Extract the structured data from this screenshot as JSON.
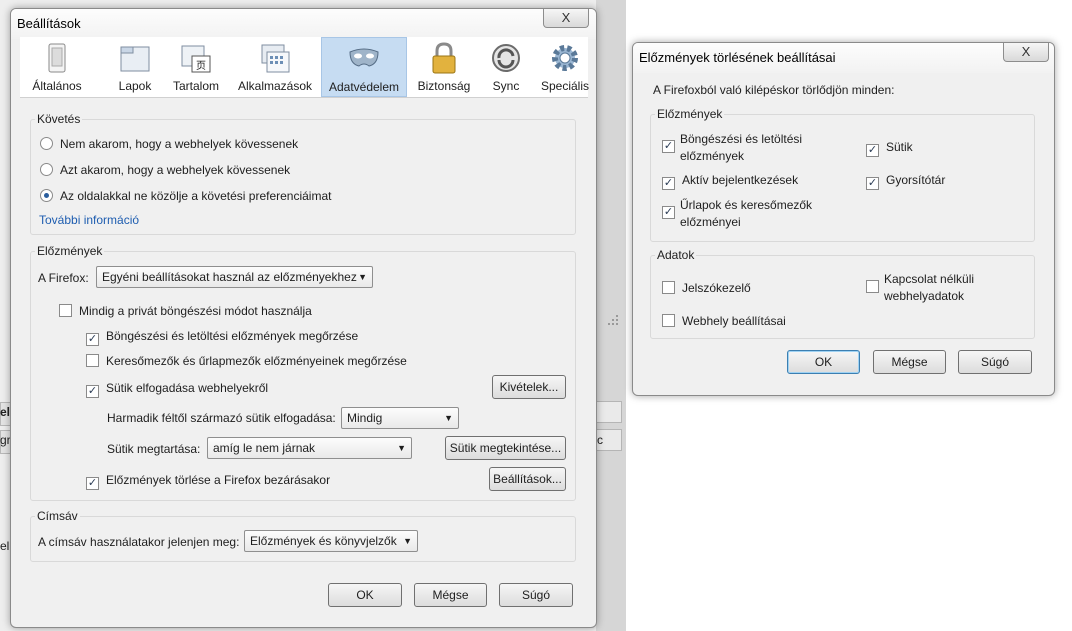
{
  "prefs": {
    "title": "Beállítások",
    "close": "X",
    "tabs": [
      {
        "label": "Általános",
        "icon": "general-icon"
      },
      {
        "label": "Lapok",
        "icon": "tabs-icon"
      },
      {
        "label": "Tartalom",
        "icon": "content-icon"
      },
      {
        "label": "Alkalmazások",
        "icon": "applications-icon"
      },
      {
        "label": "Adatvédelem",
        "icon": "privacy-mask-icon"
      },
      {
        "label": "Biztonság",
        "icon": "padlock-icon"
      },
      {
        "label": "Sync",
        "icon": "sync-icon"
      },
      {
        "label": "Speciális",
        "icon": "gear-icon"
      }
    ],
    "active_tab": "Adatvédelem",
    "tracking": {
      "title": "Követés",
      "options": [
        {
          "label": "Nem akarom, hogy a webhelyek kövessenek",
          "selected": false
        },
        {
          "label": "Azt akarom, hogy a webhelyek kövessenek",
          "selected": false
        },
        {
          "label": "Az oldalakkal ne közölje a követési preferenciáimat",
          "selected": true
        }
      ],
      "more_info": "További információ"
    },
    "history": {
      "title": "Előzmények",
      "firefox_label": "A Firefox:",
      "firefox_value": "Egyéni beállításokat használ az előzményekhez",
      "private_mode": {
        "label": "Mindig a privát böngészési módot használja",
        "checked": false
      },
      "keep_history": {
        "label": "Böngészési és letöltési előzmények megőrzése",
        "checked": true
      },
      "keep_forms": {
        "label": "Keresőmezők és űrlapmezők előzményeinek megőrzése",
        "checked": false
      },
      "accept_cookies": {
        "label": "Sütik elfogadása webhelyekről",
        "checked": true
      },
      "exceptions_button": "Kivételek...",
      "third_party_label": "Harmadik féltől származó sütik elfogadása:",
      "third_party_value": "Mindig",
      "keep_until_label": "Sütik megtartása:",
      "keep_until_value": "amíg le nem járnak",
      "show_cookies_button": "Sütik megtekintése...",
      "clear_on_close": {
        "label": "Előzmények törlése a Firefox bezárásakor",
        "checked": true
      },
      "settings_button": "Beállítások..."
    },
    "location_bar": {
      "title": "Címsáv",
      "label": "A címsáv használatakor jelenjen meg:",
      "value": "Előzmények és könyvjelzők"
    },
    "buttons": {
      "ok": "OK",
      "cancel": "Mégse",
      "help": "Súgó"
    }
  },
  "clear": {
    "title": "Előzmények törlésének beállításai",
    "close": "X",
    "intro": "A Firefoxból való kilépéskor törlődjön minden:",
    "history_group": {
      "title": "Előzmények",
      "items": [
        {
          "label": "Böngészési és letöltési előzmények",
          "checked": true
        },
        {
          "label": "Sütik",
          "checked": true
        },
        {
          "label": "Aktív bejelentkezések",
          "checked": true
        },
        {
          "label": "Gyorsítótár",
          "checked": true
        },
        {
          "label": "Űrlapok és keresőmezők előzményei",
          "checked": true
        }
      ]
    },
    "data_group": {
      "title": "Adatok",
      "items": [
        {
          "label": "Jelszókezelő",
          "checked": false
        },
        {
          "label": "Kapcsolat nélküli webhelyadatok",
          "checked": false
        },
        {
          "label": "Webhely beállításai",
          "checked": false
        }
      ]
    },
    "buttons": {
      "ok": "OK",
      "cancel": "Mégse",
      "help": "Súgó"
    }
  },
  "background": {
    "partial_1": "elk",
    "partial_2": "gr",
    "partial_3": "el",
    "partial_4": "c"
  },
  "colors": {
    "accent": "#1e5db0",
    "active_tab_bg": "#c6dcf2",
    "window_bg": "#f0f0f0"
  }
}
